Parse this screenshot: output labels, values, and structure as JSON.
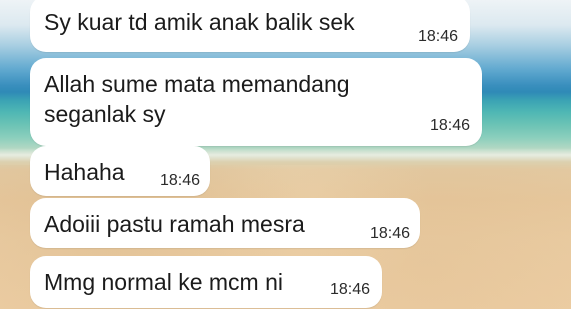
{
  "messages": [
    {
      "text": "Sy kuar td amik anak balik sek",
      "time": "18:46"
    },
    {
      "text": "Allah sume mata memandang seganlak sy",
      "time": "18:46"
    },
    {
      "text": "Hahaha",
      "time": "18:46"
    },
    {
      "text": "Adoiii pastu ramah mesra",
      "time": "18:46"
    },
    {
      "text": "Mmg normal ke mcm ni",
      "time": "18:46"
    }
  ],
  "colors": {
    "bubble": "#ffffff",
    "text": "#1b1b1b"
  }
}
